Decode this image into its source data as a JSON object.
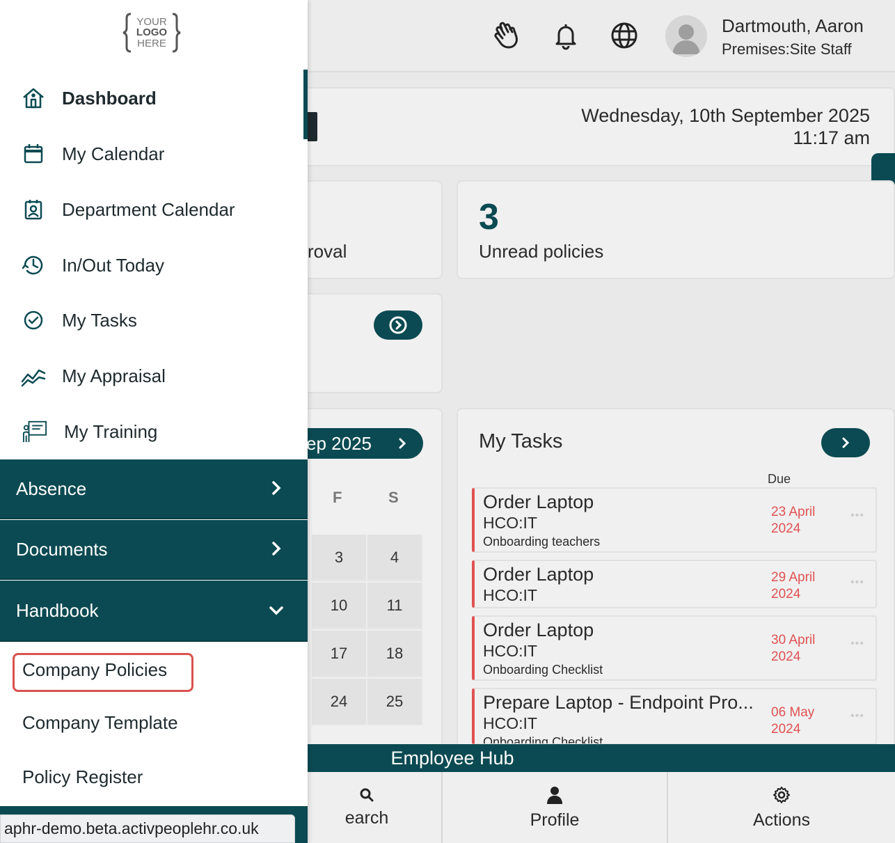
{
  "header": {
    "user_name": "Dartmouth, Aaron",
    "user_role": "Premises:Site Staff",
    "icons": [
      "wave-hand-icon",
      "bell-icon",
      "globe-icon",
      "avatar"
    ]
  },
  "welcome": {
    "date": "Wednesday, 10th September 2025",
    "time": "11:17 am"
  },
  "stats": {
    "approval_label_fragment": "roval",
    "unread_count": "3",
    "unread_label": "Unread policies"
  },
  "calendar": {
    "month_label": "ep 2025",
    "days_of_week": [
      "F",
      "S"
    ],
    "rows": [
      [
        "3",
        "4"
      ],
      [
        "10",
        "11"
      ],
      [
        "17",
        "18"
      ],
      [
        "24",
        "25"
      ]
    ]
  },
  "tasks": {
    "title": "My Tasks",
    "due_header": "Due",
    "items": [
      {
        "title": "Order Laptop",
        "sub": "HCO:IT",
        "note": "Onboarding teachers",
        "due1": "23 April",
        "due2": "2024"
      },
      {
        "title": "Order Laptop",
        "sub": "HCO:IT",
        "note": "",
        "due1": "29 April",
        "due2": "2024"
      },
      {
        "title": "Order Laptop",
        "sub": "HCO:IT",
        "note": "Onboarding Checklist",
        "due1": "30 April",
        "due2": "2024"
      },
      {
        "title": "Prepare Laptop - Endpoint Pro...",
        "sub": "HCO:IT",
        "note": "Onboarding Checklist",
        "due1": "06 May",
        "due2": "2024"
      }
    ]
  },
  "hub": {
    "title": "Employee Hub",
    "nav": [
      {
        "label": "earch",
        "icon": "search-icon"
      },
      {
        "label": "Profile",
        "icon": "person-icon"
      },
      {
        "label": "Actions",
        "icon": "gear-icon"
      }
    ]
  },
  "drawer": {
    "logo_lines": [
      "YOUR",
      "LOGO",
      "HERE"
    ],
    "items": [
      {
        "label": "Dashboard",
        "icon": "home-icon"
      },
      {
        "label": "My Calendar",
        "icon": "calendar-icon"
      },
      {
        "label": "Department Calendar",
        "icon": "department-calendar-icon"
      },
      {
        "label": "In/Out Today",
        "icon": "clock-history-icon"
      },
      {
        "label": "My Tasks",
        "icon": "check-circle-icon"
      },
      {
        "label": "My Appraisal",
        "icon": "chart-line-icon"
      },
      {
        "label": "My Training",
        "icon": "training-board-icon"
      }
    ],
    "sections": [
      {
        "label": "Absence",
        "state": "collapsed"
      },
      {
        "label": "Documents",
        "state": "collapsed"
      },
      {
        "label": "Handbook",
        "state": "expanded"
      }
    ],
    "handbook_items": [
      "Company Policies",
      "Company Template",
      "Policy Register"
    ],
    "highlighted_item": "Company Policies"
  },
  "status_bar": {
    "url": "aphr-demo.beta.activpeoplehr.co.uk"
  },
  "colors": {
    "primary": "#0b4a52",
    "due": "#e05252",
    "highlight": "#d9534f"
  }
}
